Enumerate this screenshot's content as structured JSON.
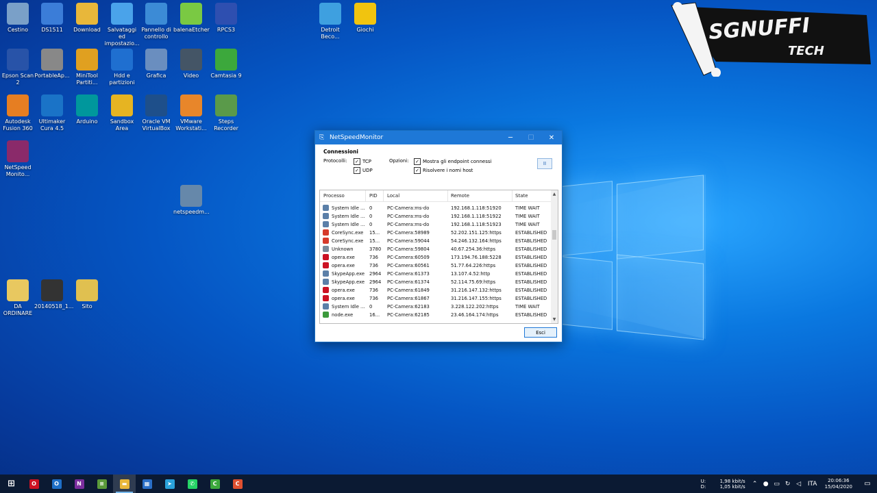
{
  "desktop": {
    "icons": [
      {
        "label": "Cestino",
        "icon": "recycle-bin-icon",
        "color": "#7aa0c8"
      },
      {
        "label": "DS1511",
        "icon": "computer-icon",
        "color": "#3b7dd8"
      },
      {
        "label": "Download",
        "icon": "folder-icon",
        "color": "#e8b73a"
      },
      {
        "label": "Salvataggi ed impostazio...",
        "icon": "cloud-icon",
        "color": "#4aa3ea"
      },
      {
        "label": "Pannello di controllo",
        "icon": "control-panel-icon",
        "color": "#3c8bd6"
      },
      {
        "label": "balenaEtcher",
        "icon": "cube-icon",
        "color": "#7ac943"
      },
      {
        "label": "RPCS3",
        "icon": "rpcs3-icon",
        "color": "#2e4fb0"
      },
      {
        "label": "Detroit Beco...",
        "icon": "detroit-icon",
        "color": "#3ea0e0"
      },
      {
        "label": "Giochi",
        "icon": "star-icon",
        "color": "#f1c40f"
      },
      {
        "label": "Epson Scan 2",
        "icon": "scanner-icon",
        "color": "#2853a8"
      },
      {
        "label": "PortableAp...",
        "icon": "portableapps-icon",
        "color": "#888888"
      },
      {
        "label": "MiniTool Partiti...",
        "icon": "minitool-icon",
        "color": "#e0a020"
      },
      {
        "label": "Hdd e partizioni",
        "icon": "disk-icon",
        "color": "#1f6fd0"
      },
      {
        "label": "Grafica",
        "icon": "picture-icon",
        "color": "#6a8ebf"
      },
      {
        "label": "Video",
        "icon": "film-icon",
        "color": "#445566"
      },
      {
        "label": "Camtasia 9",
        "icon": "camtasia-icon",
        "color": "#3ca83c"
      },
      {
        "label": "Autodesk Fusion 360",
        "icon": "fusion-icon",
        "color": "#e67e22"
      },
      {
        "label": "Ultimaker Cura 4.5",
        "icon": "cura-icon",
        "color": "#1a73c7"
      },
      {
        "label": "Arduino",
        "icon": "arduino-icon",
        "color": "#00979c"
      },
      {
        "label": "Sandbox Area",
        "icon": "lock-icon",
        "color": "#e6b422"
      },
      {
        "label": "Oracle VM VirtualBox",
        "icon": "virtualbox-icon",
        "color": "#1e4f8a"
      },
      {
        "label": "VMware Workstati...",
        "icon": "vmware-icon",
        "color": "#e8862a"
      },
      {
        "label": "Steps Recorder",
        "icon": "steps-recorder-icon",
        "color": "#5a9a4a"
      },
      {
        "label": "NetSpeed Monito...",
        "icon": "winrar-icon",
        "color": "#8a2a6a"
      },
      {
        "label": "netspeedm...",
        "icon": "installer-icon",
        "color": "#6688aa"
      },
      {
        "label": "DA ORDINARE",
        "icon": "folder-icon",
        "color": "#e8c860"
      },
      {
        "label": "20140518_1...",
        "icon": "photo-icon",
        "color": "#333333"
      },
      {
        "label": "Sito",
        "icon": "folder-icon",
        "color": "#e0c050"
      }
    ]
  },
  "watermark": {
    "line1": "SGNUFFI",
    "line2": "TECH"
  },
  "window": {
    "title": "NetSpeedMonitor",
    "minimize": "─",
    "maximize": "☐",
    "close": "✕",
    "group_title": "Connessioni",
    "protocols_label": "Protocolli:",
    "tcp_label": "TCP",
    "udp_label": "UDP",
    "options_label": "Opzioni:",
    "opt_endpoints": "Mostra gli endpoint connessi",
    "opt_resolve": "Risolvere i nomi host",
    "pause_label": "II",
    "exit_label": "Esci",
    "columns": {
      "process": "Processo",
      "pid": "PID",
      "local": "Local",
      "remote": "Remote",
      "state": "State"
    },
    "rows": [
      {
        "process": "System Idle ...",
        "pid": "0",
        "local": "PC-Camera:ms-do",
        "remote": "192.168.1.118:51920",
        "state": "TIME WAIT",
        "icon": "system-icon",
        "color": "#5b7fa8"
      },
      {
        "process": "System Idle ...",
        "pid": "0",
        "local": "PC-Camera:ms-do",
        "remote": "192.168.1.118:51922",
        "state": "TIME WAIT",
        "icon": "system-icon",
        "color": "#5b7fa8"
      },
      {
        "process": "System Idle ...",
        "pid": "0",
        "local": "PC-Camera:ms-do",
        "remote": "192.168.1.118:51923",
        "state": "TIME WAIT",
        "icon": "system-icon",
        "color": "#5b7fa8"
      },
      {
        "process": "CoreSync.exe",
        "pid": "15...",
        "local": "PC-Camera:58989",
        "remote": "52.202.151.125:https",
        "state": "ESTABLISHED",
        "icon": "coresync-icon",
        "color": "#d63a2a"
      },
      {
        "process": "CoreSync.exe",
        "pid": "15...",
        "local": "PC-Camera:59044",
        "remote": "54.246.132.164:https",
        "state": "ESTABLISHED",
        "icon": "coresync-icon",
        "color": "#d63a2a"
      },
      {
        "process": "Unknown",
        "pid": "3780",
        "local": "PC-Camera:59804",
        "remote": "40.67.254.36:https",
        "state": "ESTABLISHED",
        "icon": "unknown-icon",
        "color": "#7a8a9a"
      },
      {
        "process": "opera.exe",
        "pid": "736",
        "local": "PC-Camera:60509",
        "remote": "173.194.76.188:5228",
        "state": "ESTABLISHED",
        "icon": "opera-icon",
        "color": "#cc1122"
      },
      {
        "process": "opera.exe",
        "pid": "736",
        "local": "PC-Camera:60561",
        "remote": "51.77.64.226:https",
        "state": "ESTABLISHED",
        "icon": "opera-icon",
        "color": "#cc1122"
      },
      {
        "process": "SkypeApp.exe",
        "pid": "2964",
        "local": "PC-Camera:61373",
        "remote": "13.107.4.52:http",
        "state": "ESTABLISHED",
        "icon": "skype-icon",
        "color": "#5b7fa8"
      },
      {
        "process": "SkypeApp.exe",
        "pid": "2964",
        "local": "PC-Camera:61374",
        "remote": "52.114.75.69:https",
        "state": "ESTABLISHED",
        "icon": "skype-icon",
        "color": "#5b7fa8"
      },
      {
        "process": "opera.exe",
        "pid": "736",
        "local": "PC-Camera:61849",
        "remote": "31.216.147.132:https",
        "state": "ESTABLISHED",
        "icon": "opera-icon",
        "color": "#cc1122"
      },
      {
        "process": "opera.exe",
        "pid": "736",
        "local": "PC-Camera:61867",
        "remote": "31.216.147.155:https",
        "state": "ESTABLISHED",
        "icon": "opera-icon",
        "color": "#cc1122"
      },
      {
        "process": "System Idle ...",
        "pid": "0",
        "local": "PC-Camera:62183",
        "remote": "3.228.122.202:https",
        "state": "TIME WAIT",
        "icon": "system-icon",
        "color": "#5b7fa8"
      },
      {
        "process": "node.exe",
        "pid": "16...",
        "local": "PC-Camera:62185",
        "remote": "23.46.164.174:https",
        "state": "ESTABLISHED",
        "icon": "node-icon",
        "color": "#3c9a3c"
      }
    ]
  },
  "taskbar": {
    "items": [
      {
        "name": "start-button",
        "glyph": "⊞",
        "color": "transparent",
        "active": false
      },
      {
        "name": "taskbar-opera",
        "glyph": "O",
        "color": "#cc1122",
        "active": false
      },
      {
        "name": "taskbar-outlook",
        "glyph": "O",
        "color": "#1e6fc8",
        "active": false
      },
      {
        "name": "taskbar-onenote",
        "glyph": "N",
        "color": "#7b2e9e",
        "active": false
      },
      {
        "name": "taskbar-notepadpp",
        "glyph": "≡",
        "color": "#5a9a3a",
        "active": false
      },
      {
        "name": "taskbar-explorer",
        "glyph": "▬",
        "color": "#e8b73a",
        "active": true
      },
      {
        "name": "taskbar-store",
        "glyph": "▦",
        "color": "#2a6fc8",
        "active": false
      },
      {
        "name": "taskbar-telegram",
        "glyph": "➤",
        "color": "#2aa1da",
        "active": false
      },
      {
        "name": "taskbar-whatsapp",
        "glyph": "✆",
        "color": "#25d366",
        "active": false
      },
      {
        "name": "taskbar-camtasia",
        "glyph": "C",
        "color": "#3ca83c",
        "active": false
      },
      {
        "name": "taskbar-camtasia-recorder",
        "glyph": "C",
        "color": "#e05030",
        "active": false
      }
    ],
    "net_up_label": "U:",
    "net_up_value": "1,98 kbit/s",
    "net_down_label": "D:",
    "net_down_value": "1,05 kbit/s",
    "language": "ITA",
    "time": "20:06:36",
    "date": "15/04/2020"
  }
}
